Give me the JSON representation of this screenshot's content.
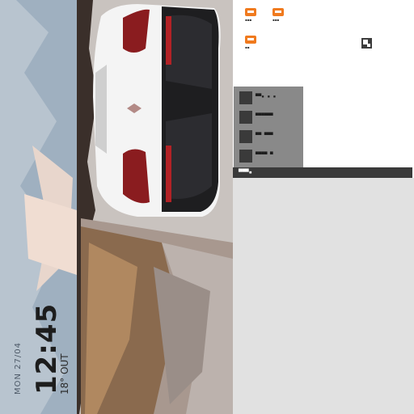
{
  "lockscreen": {
    "time": "12:45",
    "weather": "18° OUT",
    "date": "MON 27/04"
  },
  "launcher": {
    "apps": [
      {
        "name": "▪▪▪",
        "icon": "app-icon"
      },
      {
        "name": "▪▪▪",
        "icon": "app-icon"
      },
      {
        "name": "▪▪",
        "icon": "app-icon"
      }
    ],
    "corner_icon": "expand-icon"
  },
  "context_menu": {
    "items": [
      {
        "label": "▀▀▪ ▪ ▪",
        "icon": "menu-item-icon"
      },
      {
        "label": "▀▀▀▀▀▀",
        "icon": "menu-item-icon"
      },
      {
        "label": "▀▀ ▀▀▀",
        "icon": "menu-item-icon"
      },
      {
        "label": "▀▀▀▀ ▀",
        "icon": "menu-item-icon"
      }
    ]
  },
  "status_bar": {
    "label": "▀▀▀▪"
  },
  "colors": {
    "accent": "#f07a1e",
    "menu_bg": "#898989",
    "bar_bg": "#3a3a3a",
    "panel_bg": "#ffffff",
    "lower_bg": "#e1e1e1"
  }
}
